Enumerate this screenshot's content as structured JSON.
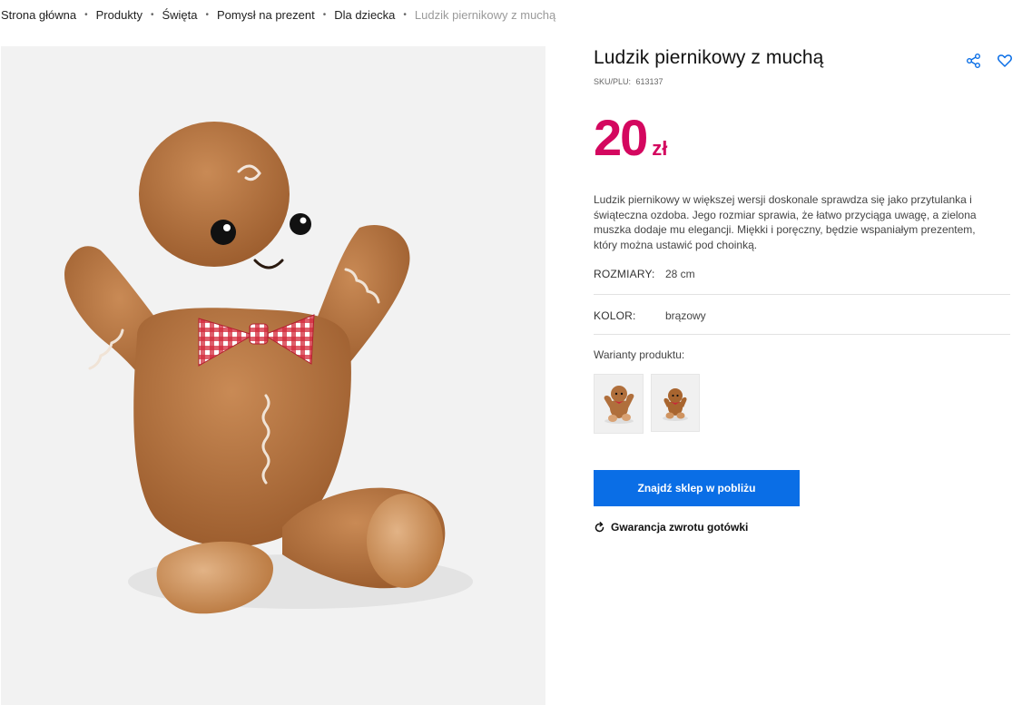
{
  "breadcrumb": {
    "items": [
      "Strona główna",
      "Produkty",
      "Święta",
      "Pomysł na prezent",
      "Dla dziecka"
    ],
    "current": "Ludzik piernikowy z muchą",
    "separator": "•"
  },
  "product": {
    "title": "Ludzik piernikowy z muchą",
    "sku_label": "SKU/PLU:",
    "sku": "613137",
    "price_value": "20",
    "price_currency": "zł",
    "description": "Ludzik piernikowy w większej wersji doskonale sprawdza się jako przytulanka i świąteczna ozdoba. Jego rozmiar sprawia, że łatwo przyciąga uwagę, a zielona muszka dodaje mu elegancji. Miękki i poręczny, będzie wspaniałym prezentem, który można ustawić pod choinką.",
    "attributes": [
      {
        "label": "ROZMIARY:",
        "value": "28 cm"
      },
      {
        "label": "KOLOR:",
        "value": "brązowy"
      }
    ],
    "variants_label": "Warianty produktu:",
    "variants": [
      {
        "name": "variant-large",
        "selected": true
      },
      {
        "name": "variant-small",
        "selected": false
      }
    ],
    "cta_label": "Znajdź sklep w pobliżu",
    "guarantee_label": "Gwarancja zwrotu gotówki"
  },
  "icons": {
    "share": "share-icon",
    "favorite": "heart-icon",
    "guarantee": "refresh-icon"
  },
  "colors": {
    "price": "#d4075f",
    "cta_background": "#0a6ee6",
    "icon_accent": "#0a6ee6",
    "image_background": "#f2f2f2"
  }
}
